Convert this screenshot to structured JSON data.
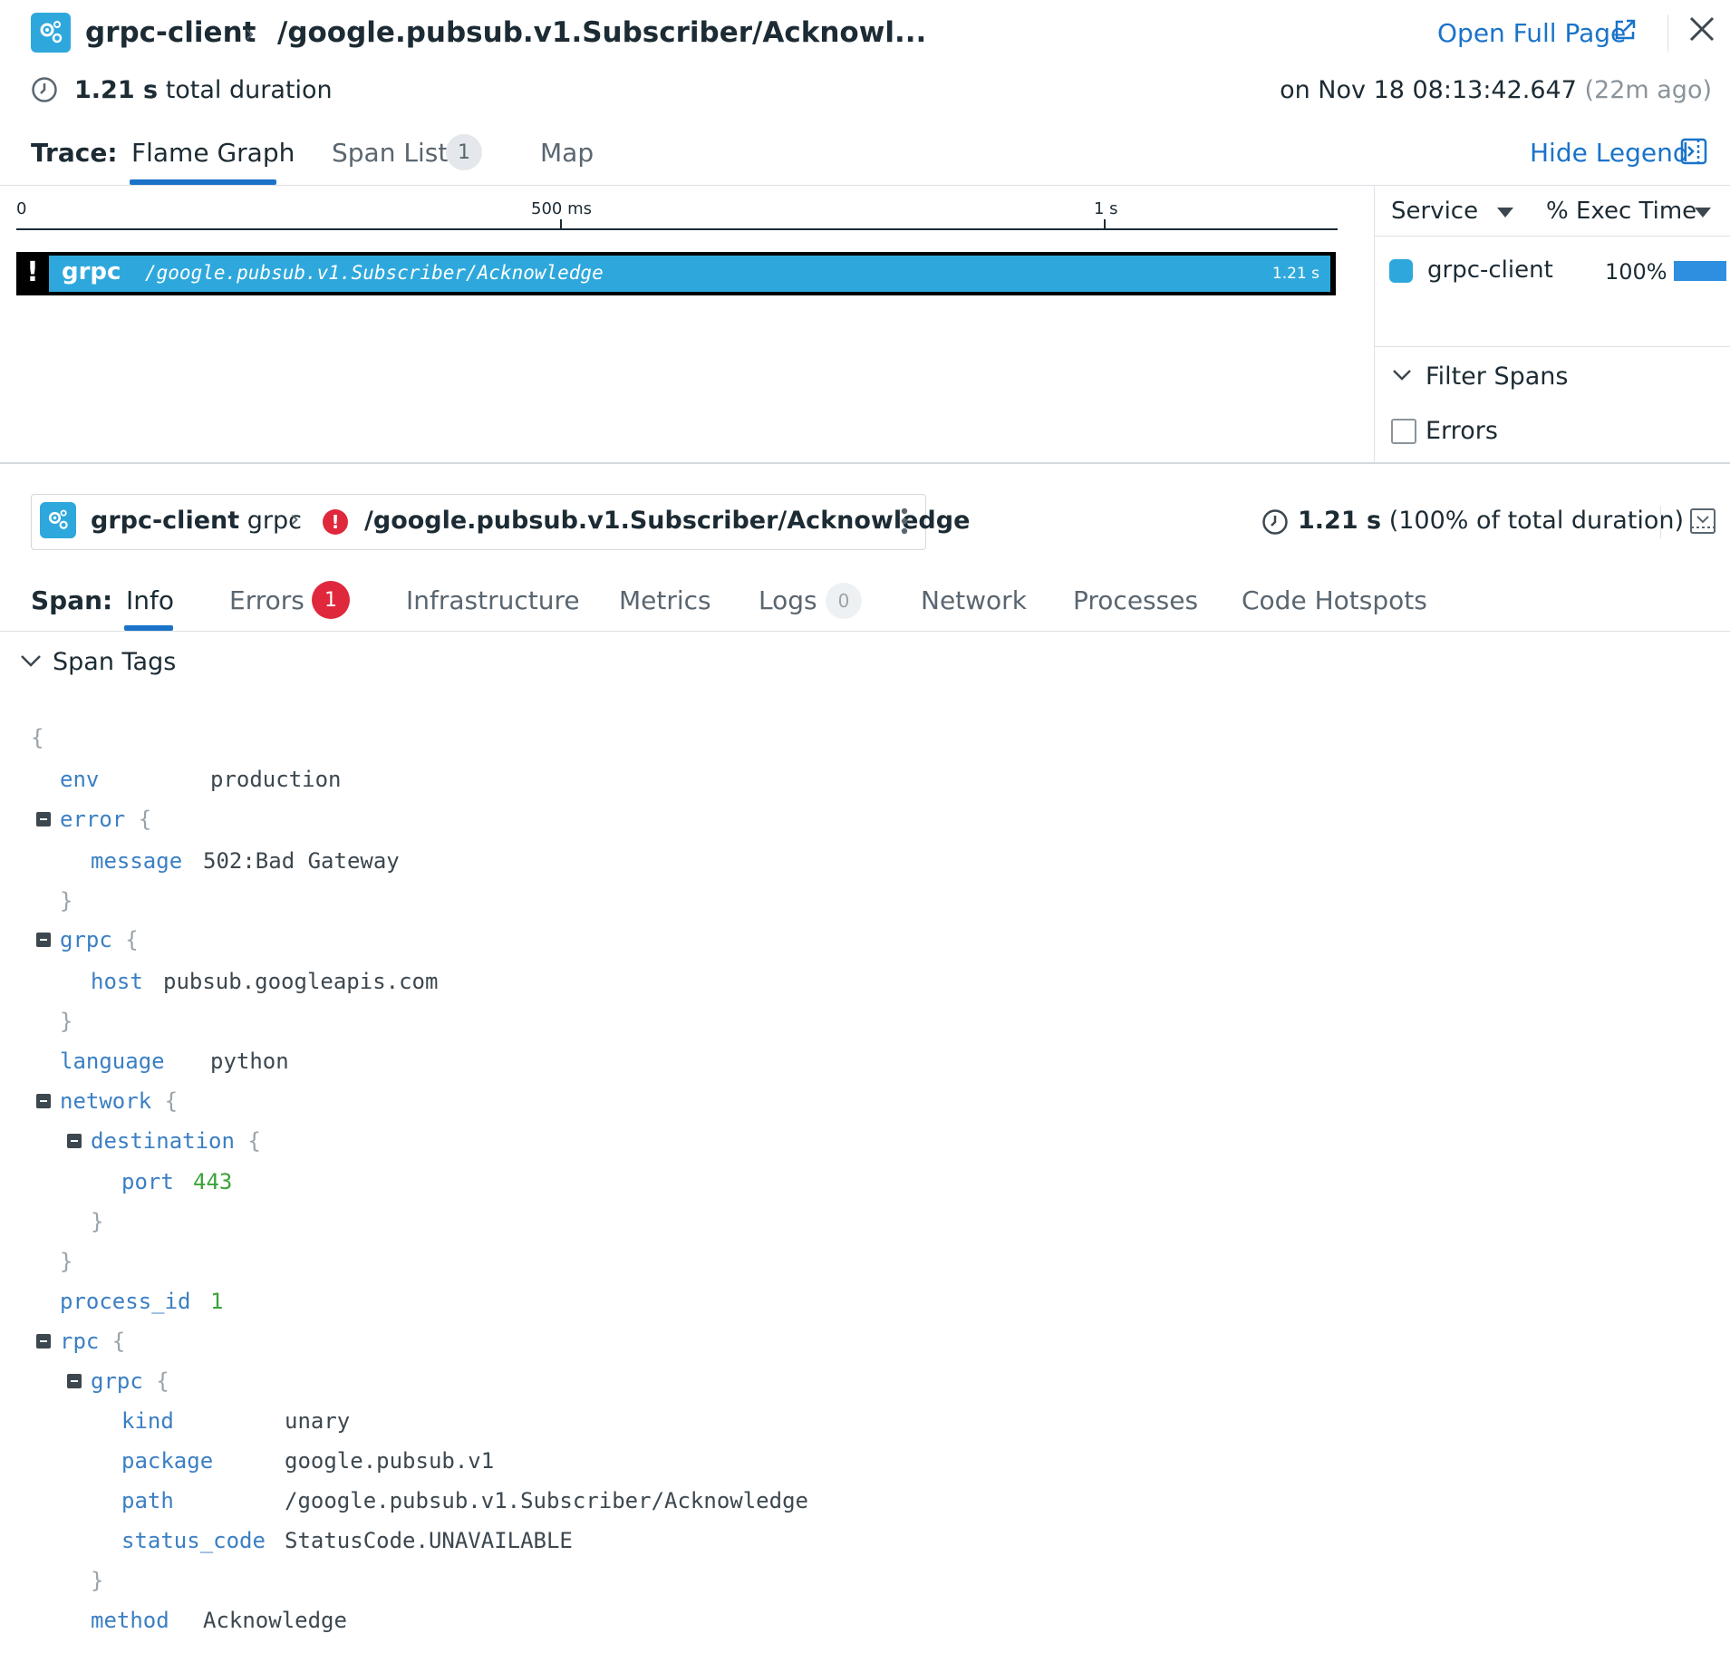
{
  "header": {
    "service": "grpc-client",
    "resource": "/google.pubsub.v1.Subscriber/Acknowl...",
    "open_full_page": "Open Full Page",
    "duration_value": "1.21 s",
    "duration_label": "total duration",
    "timestamp": "on Nov 18 08:13:42.647",
    "ago": "(22m ago)"
  },
  "trace_tabs": {
    "label": "Trace:",
    "flame_graph": "Flame Graph",
    "span_list": "Span List",
    "span_list_count": "1",
    "map": "Map",
    "hide_legend": "Hide Legend"
  },
  "timeline": {
    "ticks": [
      "0",
      "500 ms",
      "1 s"
    ],
    "span": {
      "service": "grpc",
      "resource": "/google.pubsub.v1.Subscriber/Acknowledge",
      "duration": "1.21 s",
      "error_mark": "!"
    }
  },
  "legend": {
    "col_service": "Service",
    "col_exec": "% Exec Time",
    "rows": [
      {
        "name": "grpc-client",
        "pct": "100%",
        "fraction": 1.0,
        "color": "#2ea8dc"
      }
    ],
    "filter_spans": "Filter Spans",
    "errors_checkbox": "Errors"
  },
  "span_header": {
    "service": "grpc-client",
    "operation": "grpc",
    "resource": "/google.pubsub.v1.Subscriber/Acknowledge",
    "duration_value": "1.21 s",
    "duration_detail": "(100% of total duration)"
  },
  "span_tabs": {
    "label": "Span:",
    "info": "Info",
    "errors": "Errors",
    "errors_count": "1",
    "infrastructure": "Infrastructure",
    "metrics": "Metrics",
    "logs": "Logs",
    "logs_count": "0",
    "network": "Network",
    "processes": "Processes",
    "code_hotspots": "Code Hotspots"
  },
  "span_tags": {
    "title": "Span Tags",
    "env": {
      "key": "env",
      "value": "production"
    },
    "error": {
      "key": "error",
      "message_key": "message",
      "message_value": "502:Bad Gateway"
    },
    "grpc": {
      "key": "grpc",
      "host_key": "host",
      "host_value": "pubsub.googleapis.com"
    },
    "language": {
      "key": "language",
      "value": "python"
    },
    "network": {
      "key": "network",
      "destination_key": "destination",
      "port_key": "port",
      "port_value": "443"
    },
    "process_id": {
      "key": "process_id",
      "value": "1"
    },
    "rpc": {
      "key": "rpc",
      "grpc_key": "grpc",
      "kind_key": "kind",
      "kind_value": "unary",
      "package_key": "package",
      "package_value": "google.pubsub.v1",
      "path_key": "path",
      "path_value": "/google.pubsub.v1.Subscriber/Acknowledge",
      "status_key": "status_code",
      "status_value": "StatusCode.UNAVAILABLE",
      "method_key": "method",
      "method_value": "Acknowledge"
    }
  },
  "colors": {
    "accent": "#1a73c9",
    "service": "#2ea8dc",
    "error": "#e0283c"
  }
}
